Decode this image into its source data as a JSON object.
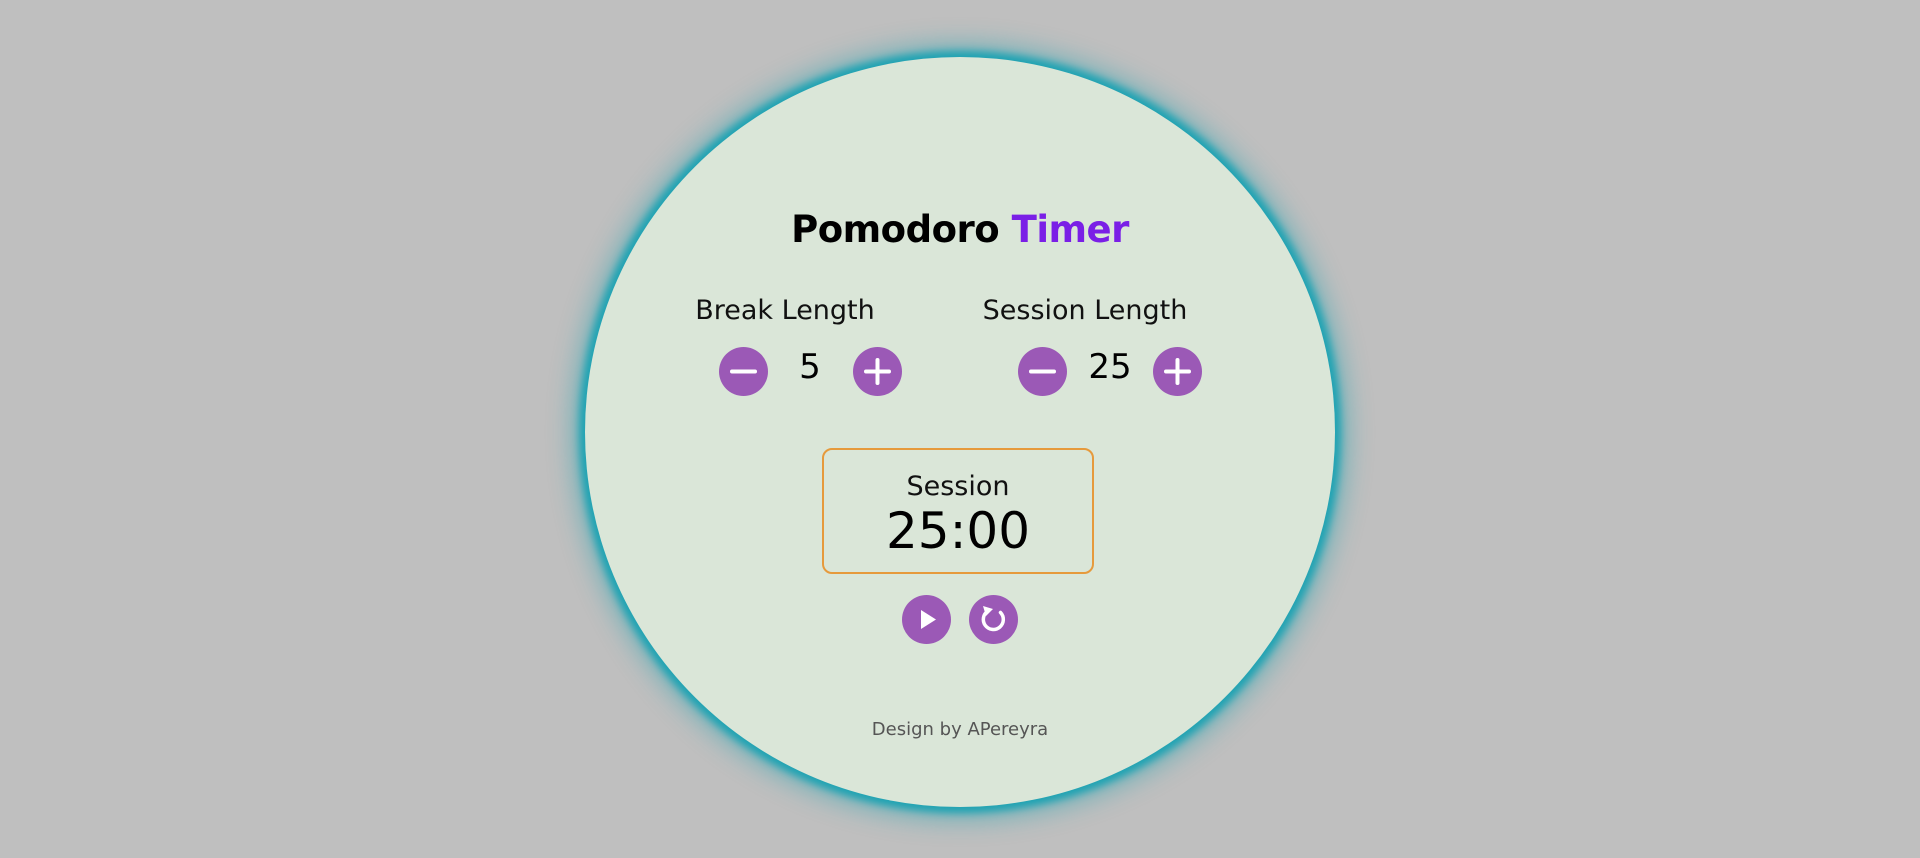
{
  "app": {
    "title_main": "Pomodoro",
    "title_accent": "Timer",
    "accent_color": "#7a1fe6",
    "button_color": "#9b59b6",
    "ring_color": "#1fa3b3",
    "display_border_color": "#e69a3c"
  },
  "break": {
    "label": "Break Length",
    "value": "5",
    "decrement_icon": "minus-icon",
    "increment_icon": "plus-icon"
  },
  "session": {
    "label": "Session Length",
    "value": "25",
    "decrement_icon": "minus-icon",
    "increment_icon": "plus-icon"
  },
  "timer": {
    "mode": "Session",
    "time": "25:00"
  },
  "controls": {
    "play_icon": "play-icon",
    "reset_icon": "reset-icon"
  },
  "footer": {
    "credit": "Design by APereyra"
  }
}
